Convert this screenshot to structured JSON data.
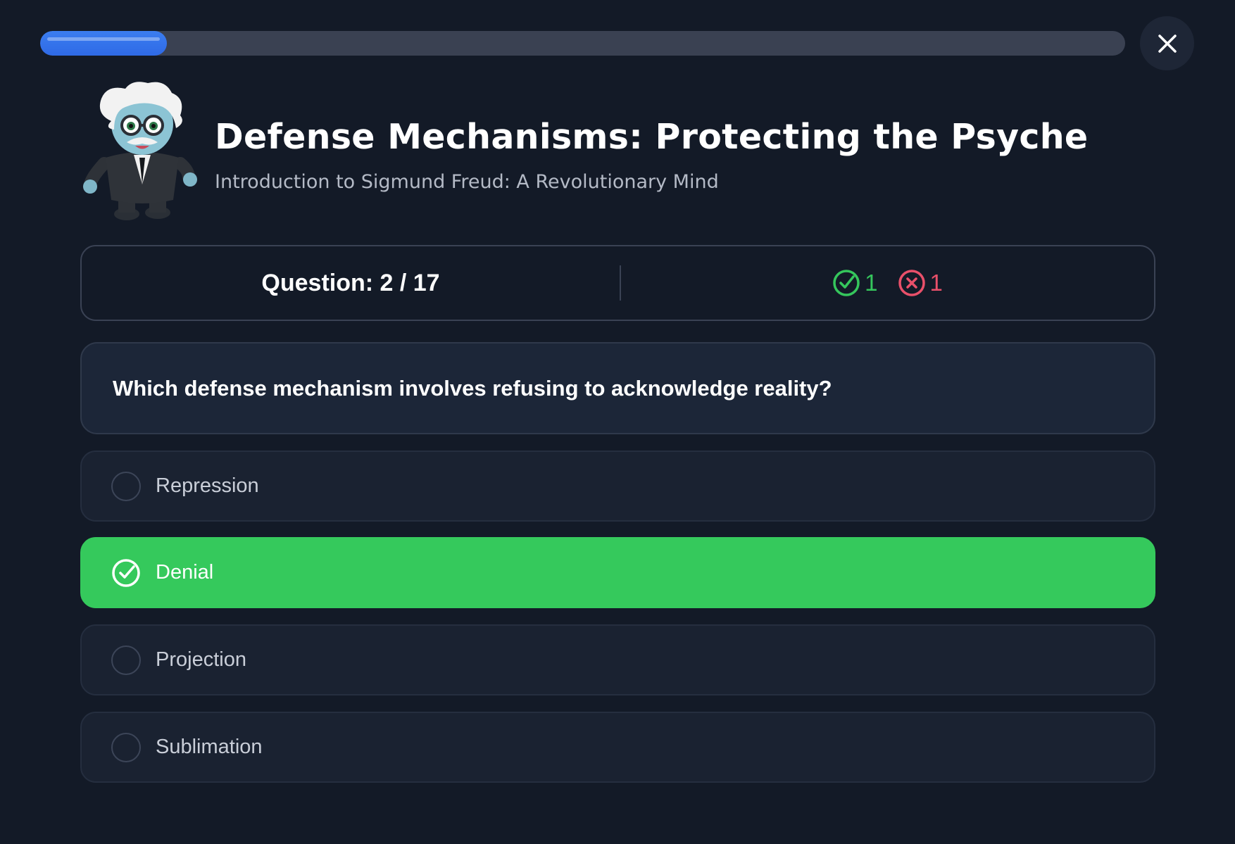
{
  "progress": {
    "fraction": 0.117
  },
  "close_icon": "close-icon",
  "header": {
    "title": "Defense Mechanisms: Protecting the Psyche",
    "subtitle": "Introduction to Sigmund Freud: A Revolutionary Mind",
    "mascot": "einstein-mascot"
  },
  "stats": {
    "question_label": "Question: 2 / 17",
    "correct_count": "1",
    "wrong_count": "1"
  },
  "question": {
    "text": "Which defense mechanism involves refusing to acknowledge reality?"
  },
  "options": [
    {
      "label": "Repression",
      "selected": false
    },
    {
      "label": "Denial",
      "selected": true
    },
    {
      "label": "Projection",
      "selected": false
    },
    {
      "label": "Sublimation",
      "selected": false
    }
  ],
  "colors": {
    "background": "#131a27",
    "accent_blue": "#2f6ae6",
    "correct_green": "#35c95c",
    "wrong_red": "#e9506a"
  }
}
